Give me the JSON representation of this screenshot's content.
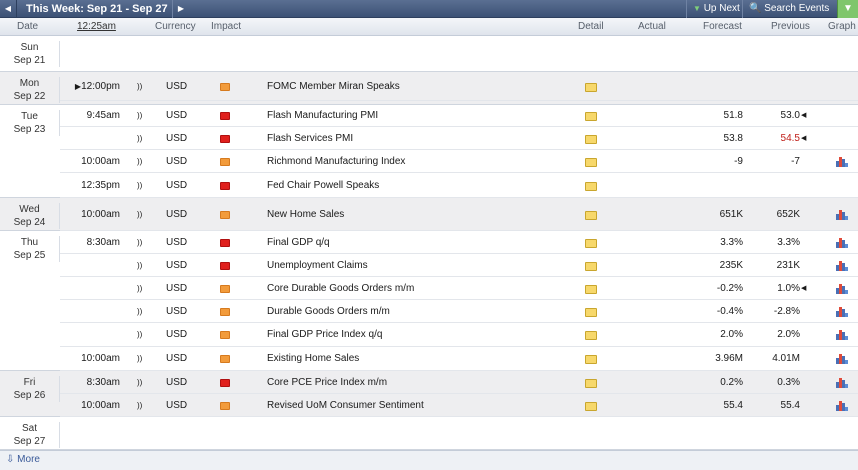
{
  "toolbar": {
    "prev_icon": "chevron-left",
    "week_label": "This Week: Sep 21 - Sep 27",
    "next_icon": "chevron-right",
    "up_next": "Up Next",
    "search_events": "Search Events",
    "filter_icon": "filter"
  },
  "columns": {
    "date": "Date",
    "time": "12:25am",
    "currency": "Currency",
    "impact": "Impact",
    "detail": "Detail",
    "actual": "Actual",
    "forecast": "Forecast",
    "previous": "Previous",
    "graph": "Graph"
  },
  "days": [
    {
      "dow": "Sun",
      "date": "Sep 21"
    },
    {
      "dow": "Mon",
      "date": "Sep 22"
    },
    {
      "dow": "Tue",
      "date": "Sep 23"
    },
    {
      "dow": "Wed",
      "date": "Sep 24"
    },
    {
      "dow": "Thu",
      "date": "Sep 25"
    },
    {
      "dow": "Fri",
      "date": "Sep 26"
    },
    {
      "dow": "Sat",
      "date": "Sep 27"
    }
  ],
  "events": [
    {
      "time": "12:00pm",
      "currency": "USD",
      "impact": "medium",
      "event": "FOMC Member Miran Speaks",
      "actual": "",
      "forecast": "",
      "previous": "",
      "graph": false
    },
    {
      "time": "9:45am",
      "currency": "USD",
      "impact": "high",
      "event": "Flash Manufacturing PMI",
      "actual": "",
      "forecast": "51.8",
      "previous": "53.0",
      "graph": false
    },
    {
      "time": "",
      "currency": "USD",
      "impact": "high",
      "event": "Flash Services PMI",
      "actual": "",
      "forecast": "53.8",
      "previous": "54.5",
      "graph": false
    },
    {
      "time": "10:00am",
      "currency": "USD",
      "impact": "medium",
      "event": "Richmond Manufacturing Index",
      "actual": "",
      "forecast": "-9",
      "previous": "-7",
      "graph": true
    },
    {
      "time": "12:35pm",
      "currency": "USD",
      "impact": "high",
      "event": "Fed Chair Powell Speaks",
      "actual": "",
      "forecast": "",
      "previous": "",
      "graph": false
    },
    {
      "time": "10:00am",
      "currency": "USD",
      "impact": "medium",
      "event": "New Home Sales",
      "actual": "",
      "forecast": "651K",
      "previous": "652K",
      "graph": true
    },
    {
      "time": "8:30am",
      "currency": "USD",
      "impact": "high",
      "event": "Final GDP q/q",
      "actual": "",
      "forecast": "3.3%",
      "previous": "3.3%",
      "graph": true
    },
    {
      "time": "",
      "currency": "USD",
      "impact": "high",
      "event": "Unemployment Claims",
      "actual": "",
      "forecast": "235K",
      "previous": "231K",
      "graph": true
    },
    {
      "time": "",
      "currency": "USD",
      "impact": "medium",
      "event": "Core Durable Goods Orders m/m",
      "actual": "",
      "forecast": "-0.2%",
      "previous": "1.0%",
      "graph": true
    },
    {
      "time": "",
      "currency": "USD",
      "impact": "medium",
      "event": "Durable Goods Orders m/m",
      "actual": "",
      "forecast": "-0.4%",
      "previous": "-2.8%",
      "graph": true
    },
    {
      "time": "",
      "currency": "USD",
      "impact": "medium",
      "event": "Final GDP Price Index q/q",
      "actual": "",
      "forecast": "2.0%",
      "previous": "2.0%",
      "graph": true
    },
    {
      "time": "10:00am",
      "currency": "USD",
      "impact": "medium",
      "event": "Existing Home Sales",
      "actual": "",
      "forecast": "3.96M",
      "previous": "4.01M",
      "graph": true
    },
    {
      "time": "8:30am",
      "currency": "USD",
      "impact": "high",
      "event": "Core PCE Price Index m/m",
      "actual": "",
      "forecast": "0.2%",
      "previous": "0.3%",
      "graph": true
    },
    {
      "time": "10:00am",
      "currency": "USD",
      "impact": "medium",
      "event": "Revised UoM Consumer Sentiment",
      "actual": "",
      "forecast": "55.4",
      "previous": "55.4",
      "graph": true
    }
  ],
  "more": "More",
  "colors": {
    "header": "#3c5175",
    "medium_impact": "#f29b3b",
    "high_impact": "#e0201d",
    "revised_previous": "#c0201a",
    "filter_button": "#7fc66c"
  }
}
